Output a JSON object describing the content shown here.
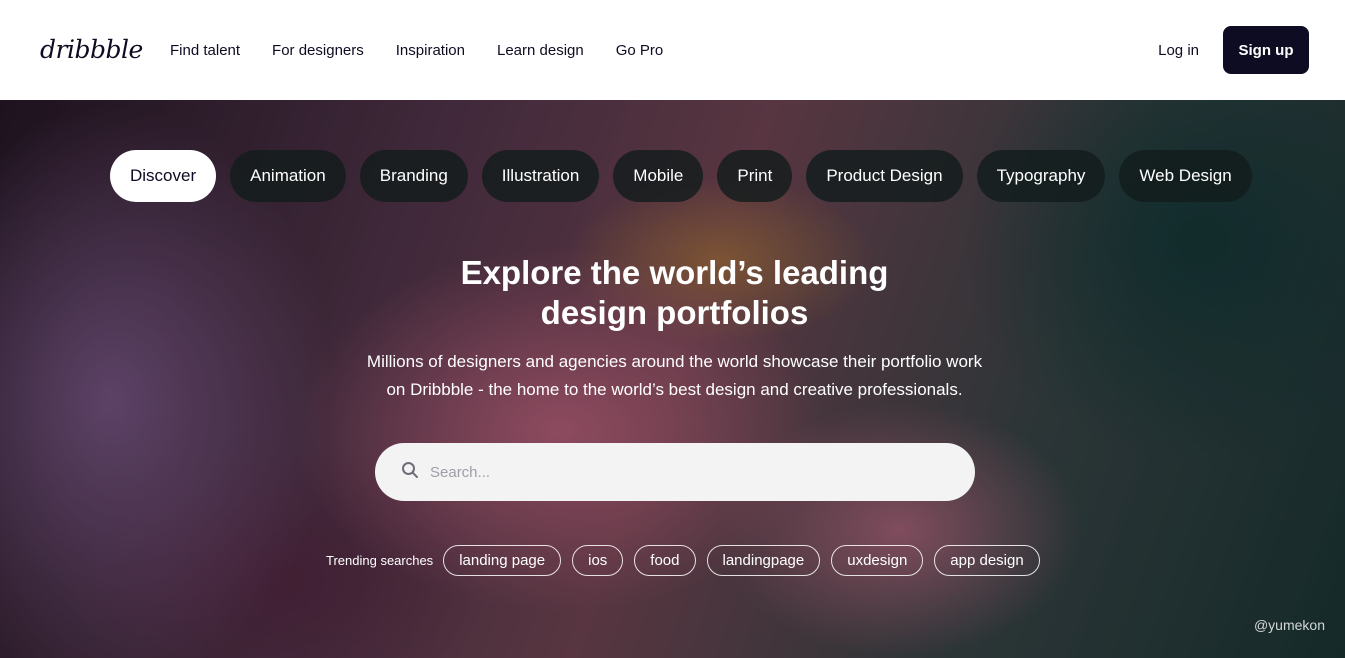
{
  "brand": {
    "logo_text": "dribbble"
  },
  "header": {
    "nav": [
      "Find talent",
      "For designers",
      "Inspiration",
      "Learn design",
      "Go Pro"
    ],
    "login_label": "Log in",
    "signup_label": "Sign up"
  },
  "hero": {
    "tabs": [
      "Discover",
      "Animation",
      "Branding",
      "Illustration",
      "Mobile",
      "Print",
      "Product Design",
      "Typography",
      "Web Design"
    ],
    "active_tab": "Discover",
    "headline_line1": "Explore the world’s leading",
    "headline_line2": "design portfolios",
    "subtext_line1": "Millions of designers and agencies around the world showcase their portfolio work",
    "subtext_line2": "on Dribbble - the home to the world’s best design and creative professionals.",
    "search": {
      "placeholder": "Search...",
      "value": ""
    },
    "trending_label": "Trending searches",
    "trending": [
      "landing page",
      "ios",
      "food",
      "landingpage",
      "uxdesign",
      "app design"
    ],
    "credit": "@yumekon"
  },
  "colors": {
    "brand_dark": "#0d0c22",
    "progress": "#4f8ff7"
  }
}
